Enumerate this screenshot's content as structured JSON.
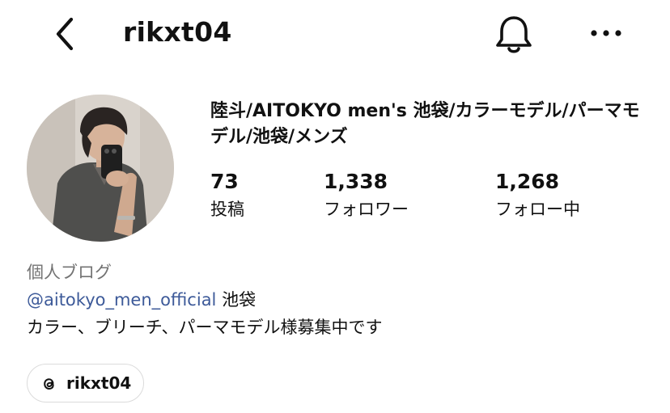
{
  "header": {
    "username": "rikxt04",
    "back_icon": "chevron-left-icon",
    "notification_icon": "bell-icon",
    "more_icon": "more-horizontal-icon"
  },
  "profile": {
    "avatar_alt": "profile-photo",
    "full_name": "陸斗/AITOKYO men's 池袋/カラーモデル/パーマモデル/池袋/メンズ",
    "stats": {
      "posts": {
        "count": "73",
        "label": "投稿"
      },
      "followers": {
        "count": "1,338",
        "label": "フォロワー"
      },
      "following": {
        "count": "1,268",
        "label": "フォロー中"
      }
    },
    "category": "個人ブログ",
    "bio": {
      "mention": "@aitokyo_men_official",
      "mention_suffix": " 池袋",
      "line2": "カラー、ブリーチ、パーマモデル様募集中です"
    },
    "threads": {
      "icon": "threads-icon",
      "label": "rikxt04"
    }
  },
  "colors": {
    "text": "#111111",
    "secondary": "#737373",
    "link": "#3d5a99",
    "border": "#dbdbdb"
  }
}
